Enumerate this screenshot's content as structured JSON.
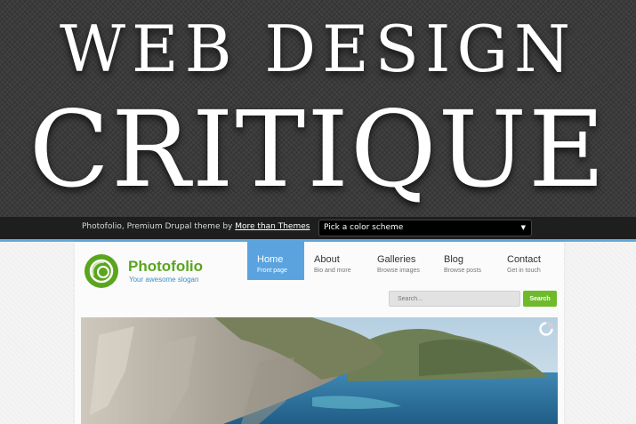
{
  "hero": {
    "line1": "WEB DESIGN",
    "line2": "CRITIQUE"
  },
  "demo_bar": {
    "text_prefix": "Photofolio, Premium Drupal theme by ",
    "link_text": "More than Themes",
    "color_scheme": "Pick a color scheme"
  },
  "site": {
    "name": "Photofolio",
    "slogan": "Your awesome slogan",
    "nav": [
      {
        "title": "Home",
        "sub": "Front page",
        "active": true
      },
      {
        "title": "About",
        "sub": "Bio and more",
        "active": false
      },
      {
        "title": "Galleries",
        "sub": "Browse images",
        "active": false
      },
      {
        "title": "Blog",
        "sub": "Browse posts",
        "active": false
      },
      {
        "title": "Contact",
        "sub": "Get in touch",
        "active": false
      }
    ],
    "search_placeholder": "Search...",
    "search_button": "Search"
  },
  "colors": {
    "brand_green": "#5ba51e",
    "nav_active_blue": "#5aa3df",
    "slogan_blue": "#3c8ec9",
    "search_green": "#6dbb2a"
  },
  "icons": {
    "logo": "photofolio-logo-icon",
    "dropdown": "chevron-down-icon",
    "slider": "slider-indicator-icon"
  }
}
